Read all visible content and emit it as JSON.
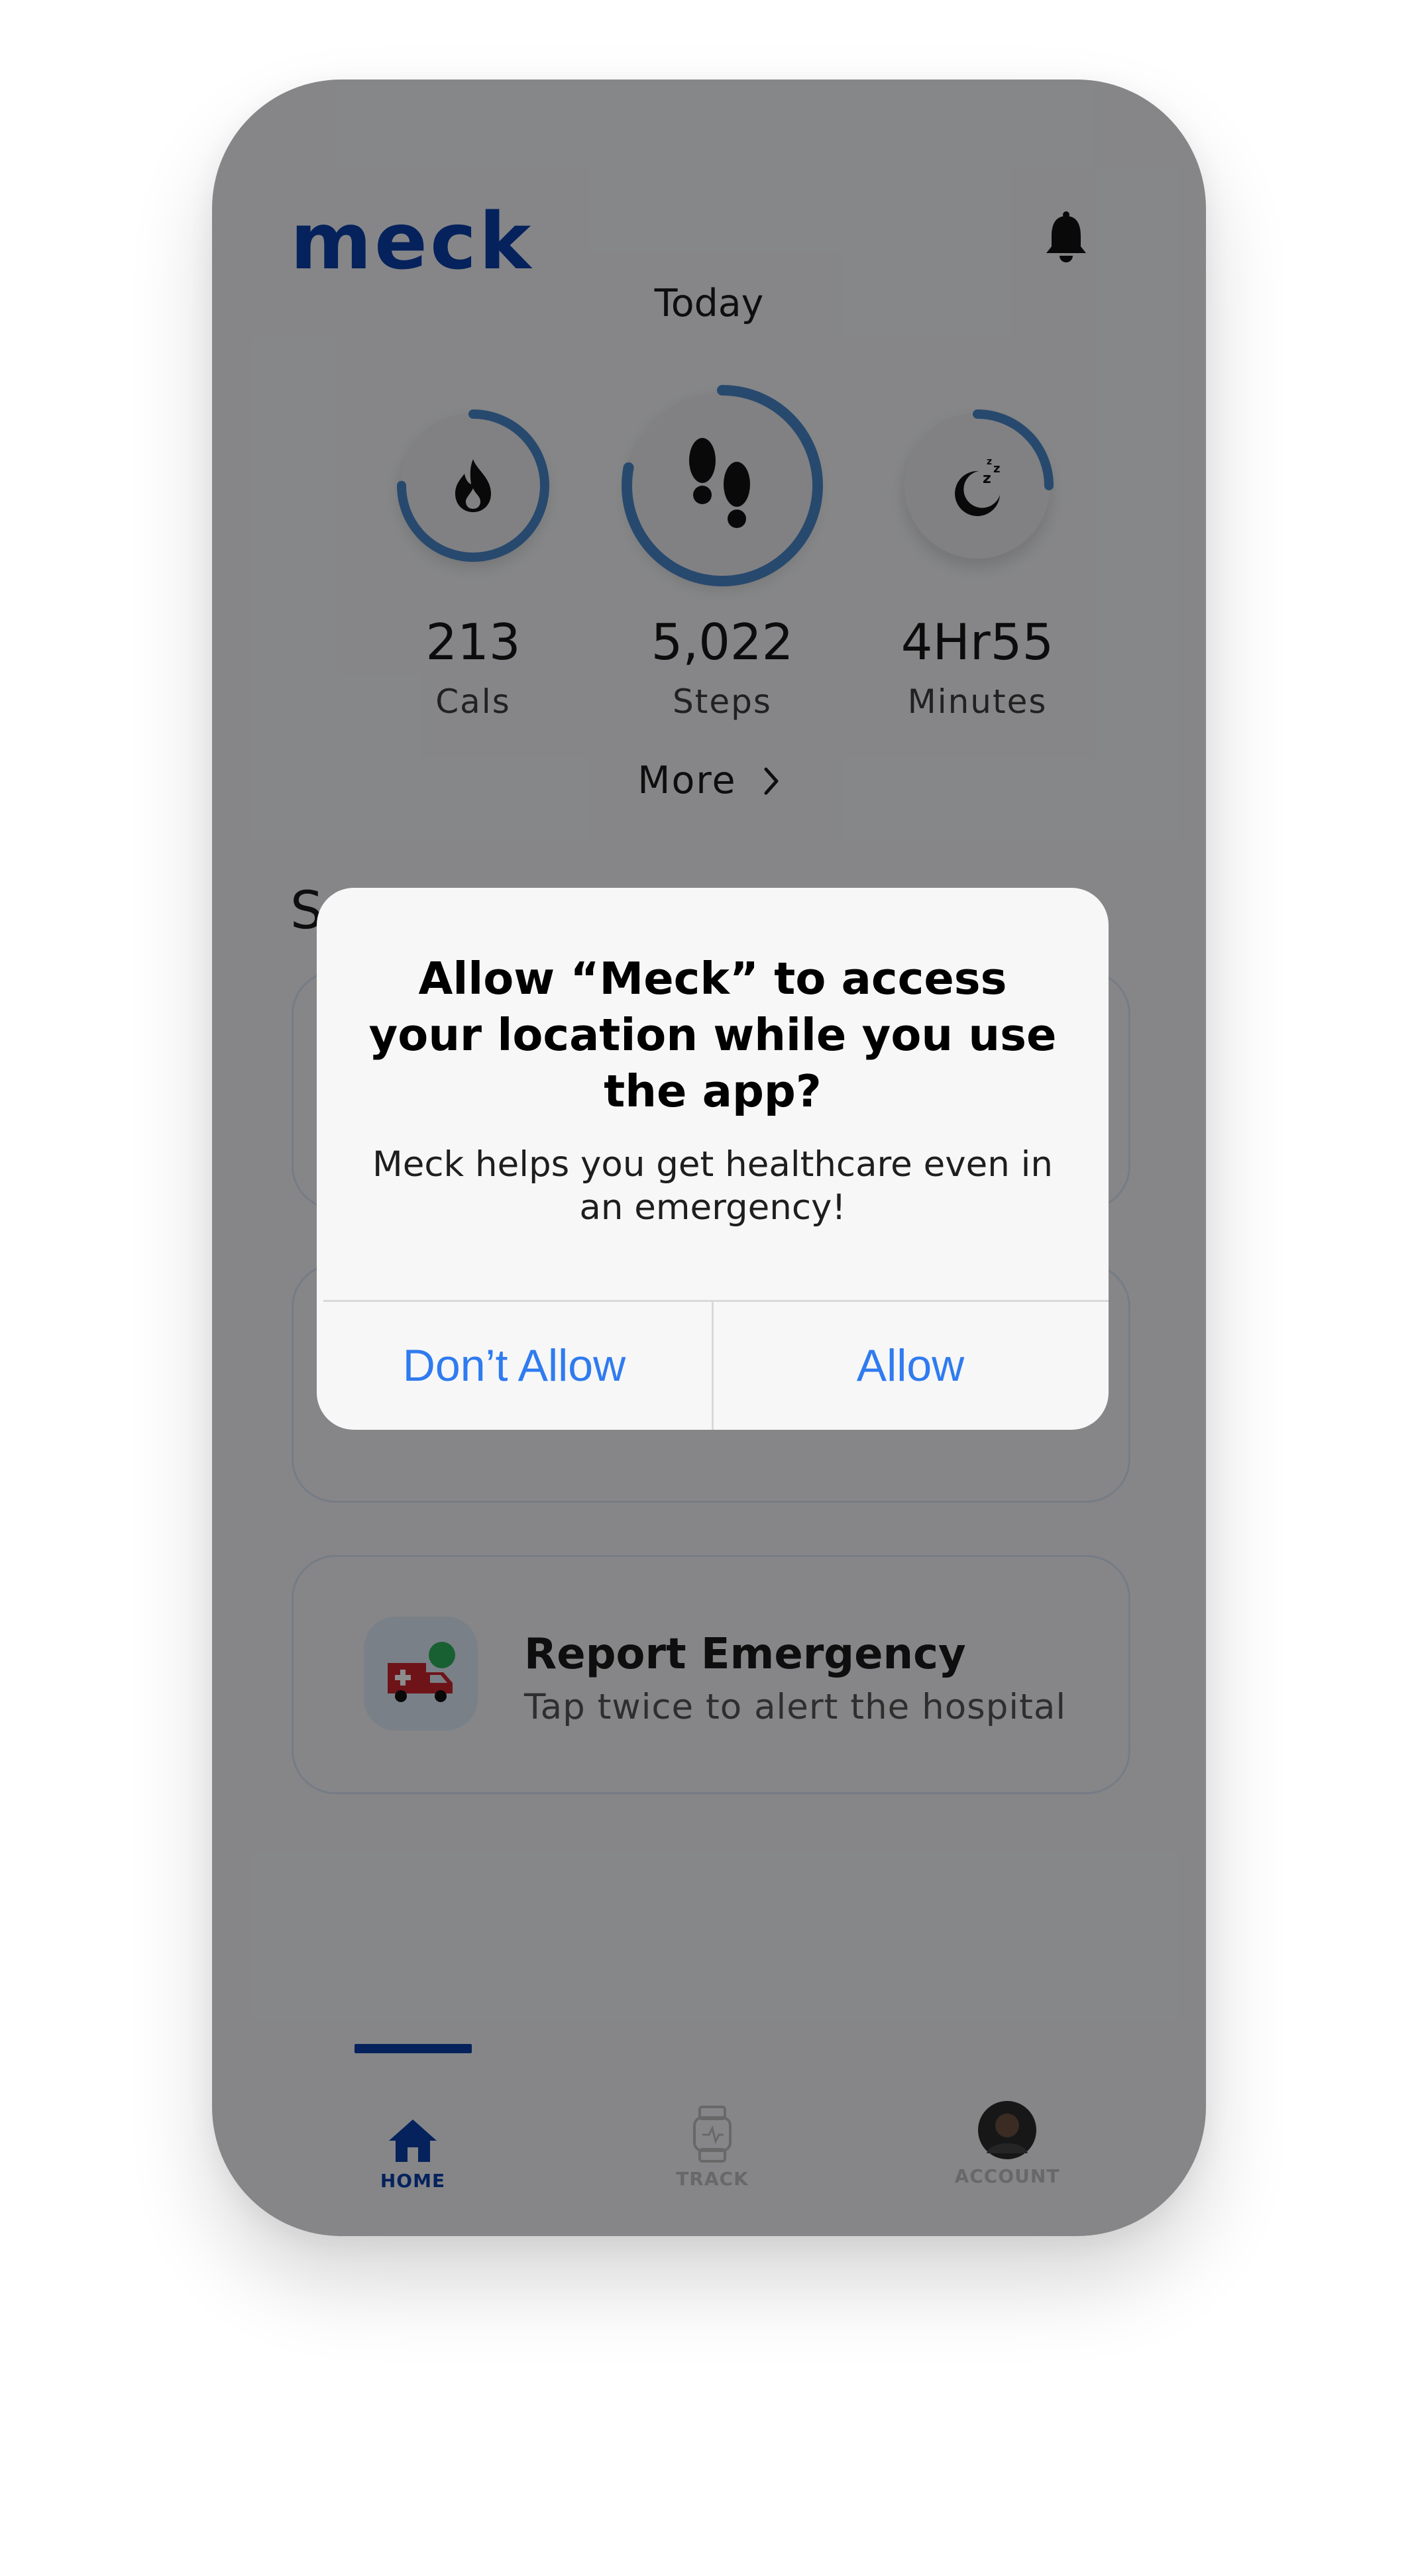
{
  "header": {
    "logo": "meck",
    "notification_icon": "bell-icon"
  },
  "today_label": "Today",
  "stats": [
    {
      "value": "213",
      "label": "Cals",
      "icon": "flame-icon",
      "progress": 0.75
    },
    {
      "value": "5,022",
      "label": "Steps",
      "icon": "footprints-icon",
      "progress": 0.78
    },
    {
      "value": "4Hr55",
      "label": "Minutes",
      "icon": "moon-sleep-icon",
      "progress": 0.25
    }
  ],
  "more_label": "More",
  "section_title": "S",
  "cards": [
    {
      "title": "Report Emergency",
      "subtitle": "Tap twice to alert the hospital",
      "icon": "ambulance-icon"
    }
  ],
  "nav": {
    "home": "HOME",
    "track": "TRACK",
    "account": "ACCOUNT"
  },
  "dialog": {
    "title": "Allow “Meck” to access your location while you use the app?",
    "message": "Meck helps you get healthcare even in an emergency!",
    "deny_label": "Don’t Allow",
    "allow_label": "Allow"
  },
  "colors": {
    "brand": "#0a3fa8",
    "ring": "#4a86c8",
    "dialog_button": "#2f7bf0",
    "emergency": "#c8262e"
  }
}
